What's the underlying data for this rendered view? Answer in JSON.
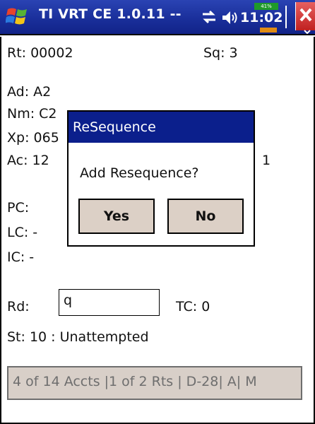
{
  "titlebar": {
    "app_title": "TI VRT CE 1.0.11 --",
    "clock": "11:02",
    "battery_pct": "41%",
    "icons": [
      "windows-logo-icon",
      "connectivity-icon",
      "volume-icon",
      "close-icon"
    ]
  },
  "form": {
    "route": "Rt: 00002",
    "sequence": "Sq: 3",
    "ad": "Ad: A2",
    "nm": "Nm: C2",
    "xp": "Xp: 065",
    "ac": "Ac: 12",
    "ac_right": "1",
    "pc": "PC:",
    "lc": "LC: -",
    "ic": "IC: -",
    "rd_label": "Rd:",
    "rd_value": "q",
    "tc": "TC: 0",
    "status": "St: 10 : Unattempted"
  },
  "status_bar": {
    "text": "4 of 14 Accts |1 of 2 Rts | D-28| A| M"
  },
  "dialog": {
    "title": "ReSequence",
    "message": "Add Resequence?",
    "yes_label": "Yes",
    "no_label": "No"
  },
  "colors": {
    "titlebar": "#1a2f9b",
    "dialog_title": "#0b1f8c",
    "button_bg": "#dcd0c6",
    "status_bg": "#d8cfc8"
  }
}
